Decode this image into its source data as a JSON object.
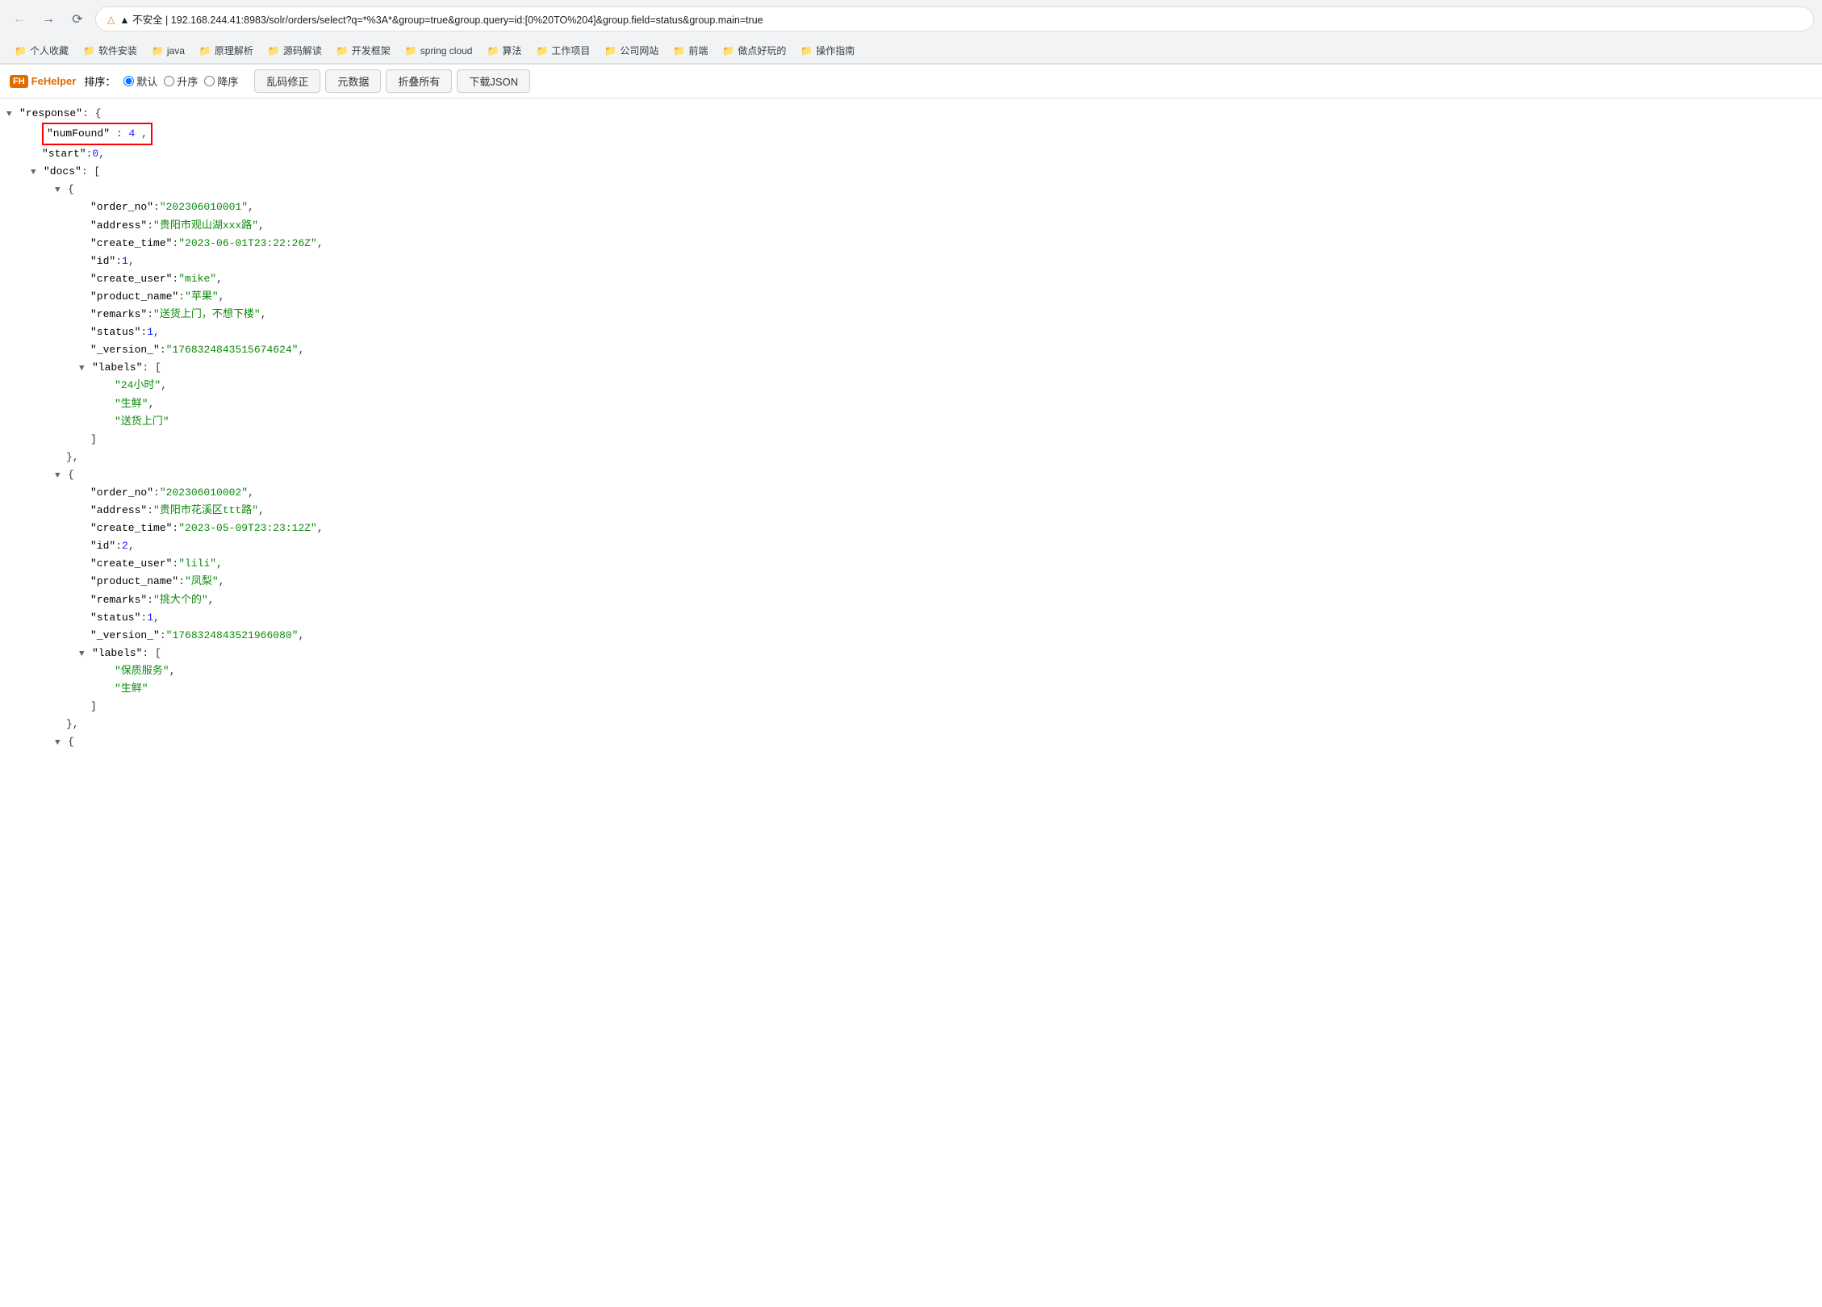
{
  "browser": {
    "url": "192.168.244.41:8983/solr/orders/select?q=*%3A*&group=true&group.query=id:[0%20TO%204]&group.field=status&group.main=true",
    "url_display": "▲ 不安全 | 192.168.244.41:8983/solr/orders/select?q=*%3A*&group=true&group.query=id:[0%20TO%204]&group.field=status&group.main=true"
  },
  "bookmarks": [
    {
      "label": "个人收藏"
    },
    {
      "label": "软件安装"
    },
    {
      "label": "java"
    },
    {
      "label": "原理解析"
    },
    {
      "label": "源码解读"
    },
    {
      "label": "开发框架"
    },
    {
      "label": "spring cloud"
    },
    {
      "label": "算法"
    },
    {
      "label": "工作项目"
    },
    {
      "label": "公司网站"
    },
    {
      "label": "前端"
    },
    {
      "label": "做点好玩的"
    },
    {
      "label": "操作指南"
    }
  ],
  "fehelper": {
    "logo": "FeHelper",
    "logo_icon": "FH",
    "sort_label": "排序：",
    "default_label": "默认",
    "asc_label": "升序",
    "desc_label": "降序",
    "btn_fix": "乱码修正",
    "btn_meta": "元数据",
    "btn_fold": "折叠所有",
    "btn_download": "下载JSON"
  },
  "json_data": {
    "response_key": "\"response\"",
    "numFound_key": "\"numFound\"",
    "numFound_val": "4",
    "start_key": "\"start\"",
    "start_val": "0",
    "docs_key": "\"docs\"",
    "order1": {
      "order_no_key": "\"order_no\"",
      "order_no_val": "\"202306010001\"",
      "address_key": "\"address\"",
      "address_val": "\"贵阳市观山湖xxx路\"",
      "create_time_key": "\"create_time\"",
      "create_time_val": "\"2023-06-01T23:22:26Z\"",
      "id_key": "\"id\"",
      "id_val": "1",
      "create_user_key": "\"create_user\"",
      "create_user_val": "\"mike\"",
      "product_name_key": "\"product_name\"",
      "product_name_val": "\"苹果\"",
      "remarks_key": "\"remarks\"",
      "remarks_val": "\"送货上门，不想下楼\"",
      "status_key": "\"status\"",
      "status_val": "1",
      "version_key": "\"_version_\"",
      "version_val": "\"1768324843515674624\"",
      "labels_key": "\"labels\"",
      "labels": [
        "\"24小时\"",
        "\"生鲜\"",
        "\"送货上门\""
      ]
    },
    "order2": {
      "order_no_key": "\"order_no\"",
      "order_no_val": "\"202306010002\"",
      "address_key": "\"address\"",
      "address_val": "\"贵阳市花溪区ttt路\"",
      "create_time_key": "\"create_time\"",
      "create_time_val": "\"2023-05-09T23:23:12Z\"",
      "id_key": "\"id\"",
      "id_val": "2",
      "create_user_key": "\"create_user\"",
      "create_user_val": "\"lili\"",
      "product_name_key": "\"product_name\"",
      "product_name_val": "\"凤梨\"",
      "remarks_key": "\"remarks\"",
      "remarks_val": "\"挑大个的\"",
      "status_key": "\"status\"",
      "status_val": "1",
      "version_key": "\"_version_\"",
      "version_val": "\"1768324843521966080\"",
      "labels_key": "\"labels\"",
      "labels": [
        "\"保质服务\"",
        "\"生鲜\""
      ]
    }
  },
  "colors": {
    "string": "#0d8a0d",
    "number": "#1a1aff",
    "key": "#000",
    "accent": "#e06c00"
  }
}
